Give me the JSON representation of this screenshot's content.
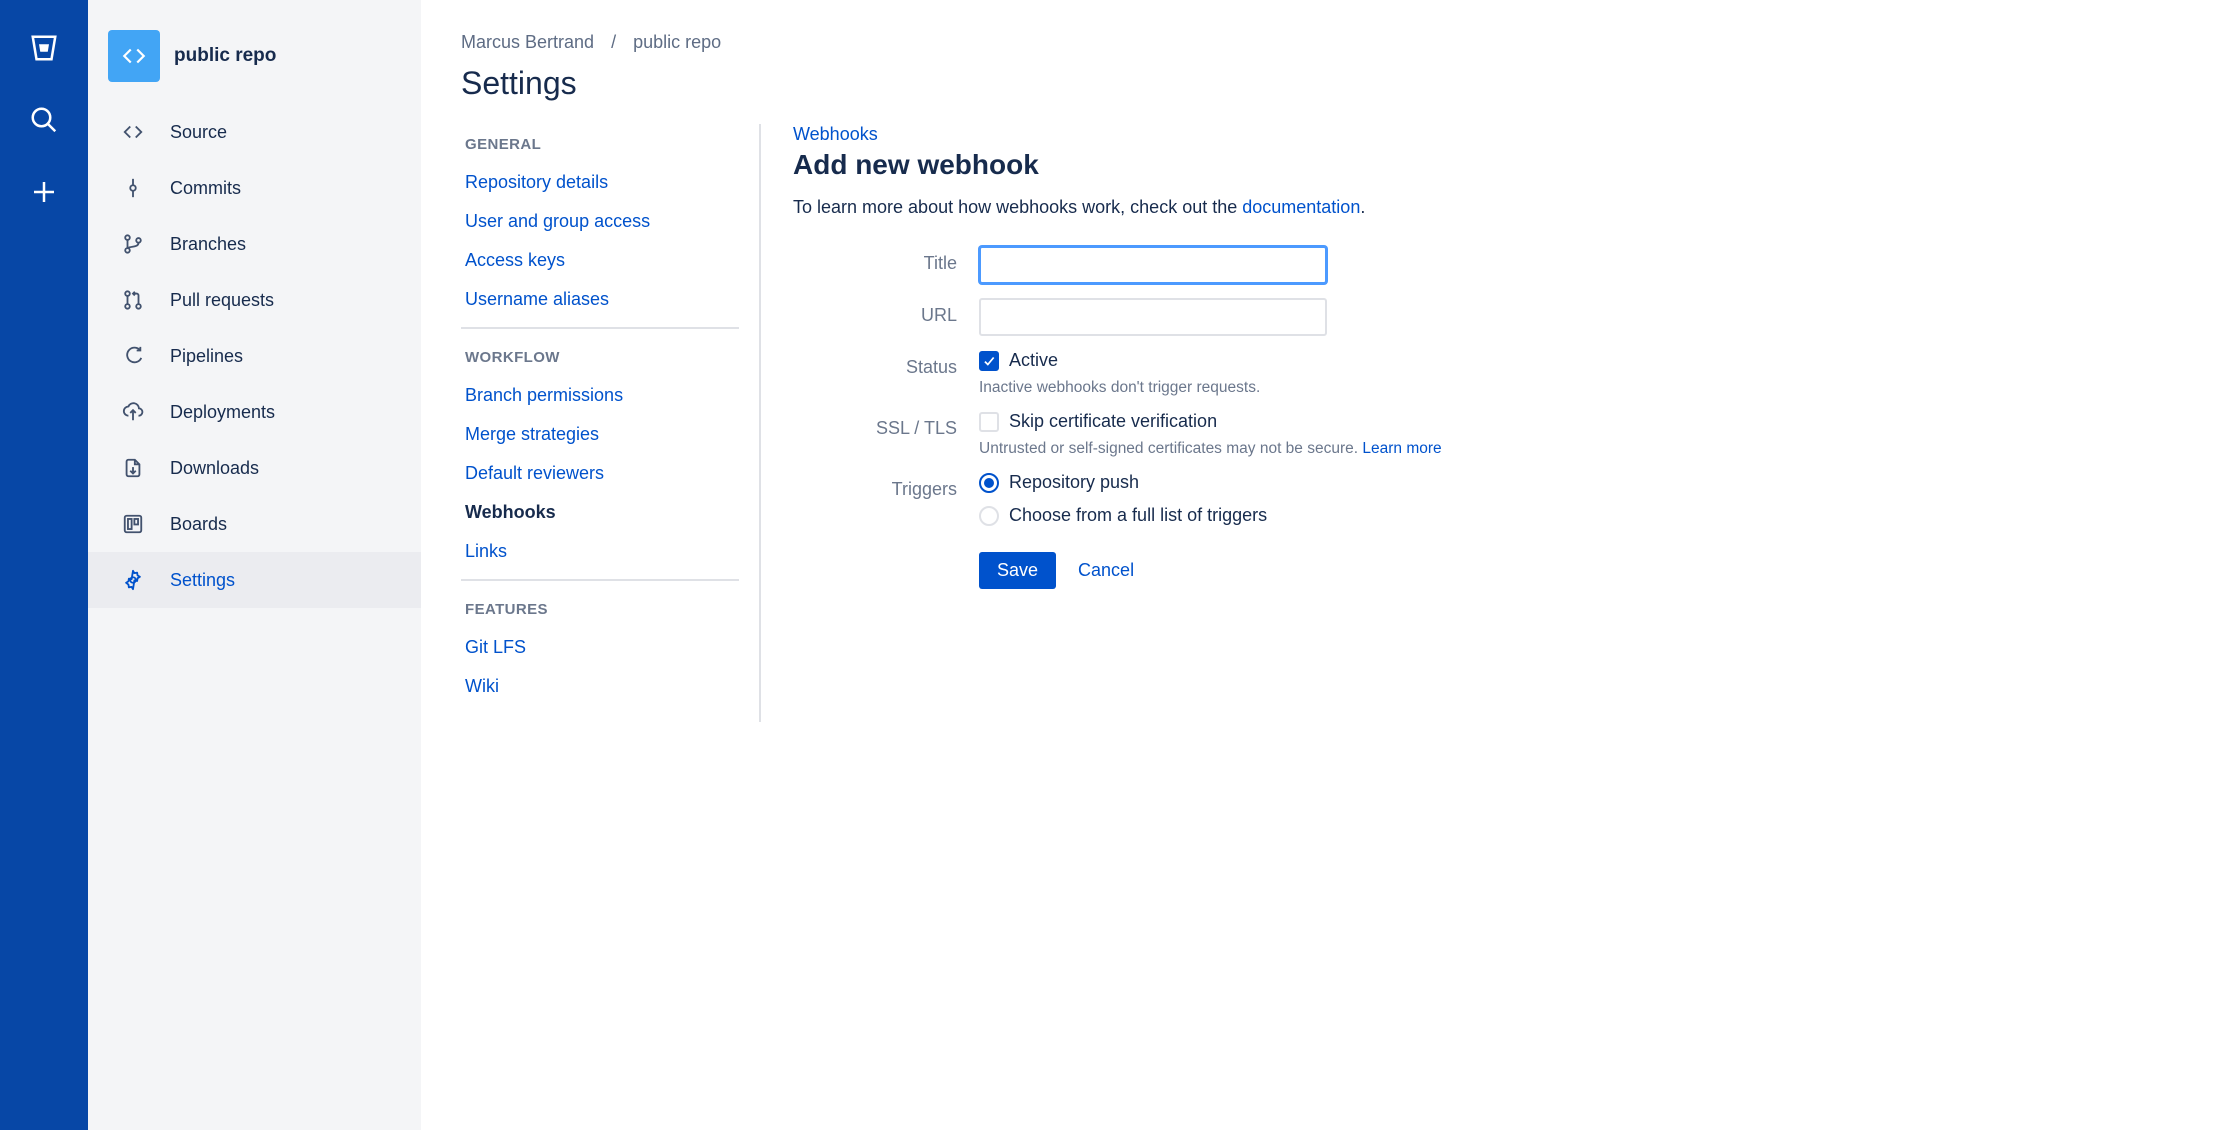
{
  "rail": {
    "items": [
      {
        "name": "logo"
      },
      {
        "name": "search"
      },
      {
        "name": "create"
      }
    ]
  },
  "repo": {
    "name": "public repo"
  },
  "nav": {
    "items": [
      {
        "label": "Source",
        "name": "source"
      },
      {
        "label": "Commits",
        "name": "commits"
      },
      {
        "label": "Branches",
        "name": "branches"
      },
      {
        "label": "Pull requests",
        "name": "pull-requests"
      },
      {
        "label": "Pipelines",
        "name": "pipelines"
      },
      {
        "label": "Deployments",
        "name": "deployments"
      },
      {
        "label": "Downloads",
        "name": "downloads"
      },
      {
        "label": "Boards",
        "name": "boards"
      },
      {
        "label": "Settings",
        "name": "settings"
      }
    ],
    "active": 8
  },
  "breadcrumb": {
    "owner": "Marcus Bertrand",
    "repo": "public repo"
  },
  "page": {
    "title": "Settings"
  },
  "settings_nav": {
    "groups": [
      {
        "head": "General",
        "items": [
          "Repository details",
          "User and group access",
          "Access keys",
          "Username aliases"
        ]
      },
      {
        "head": "Workflow",
        "items": [
          "Branch permissions",
          "Merge strategies",
          "Default reviewers",
          "Webhooks",
          "Links"
        ]
      },
      {
        "head": "Features",
        "items": [
          "Git LFS",
          "Wiki"
        ]
      }
    ],
    "active": "Webhooks"
  },
  "form": {
    "crumb": "Webhooks",
    "title": "Add new webhook",
    "desc_pre": "To learn more about how webhooks work, check out the ",
    "desc_link": "documentation",
    "desc_post": ".",
    "title_label": "Title",
    "title_value": "",
    "url_label": "URL",
    "url_value": "",
    "status_label": "Status",
    "status_option": "Active",
    "status_help": "Inactive webhooks don't trigger requests.",
    "ssl_label": "SSL / TLS",
    "ssl_option": "Skip certificate verification",
    "ssl_help_pre": "Untrusted or self-signed certificates may not be secure. ",
    "ssl_help_link": "Learn more",
    "triggers_label": "Triggers",
    "trigger_push": "Repository push",
    "trigger_full": "Choose from a full list of triggers",
    "save": "Save",
    "cancel": "Cancel"
  }
}
